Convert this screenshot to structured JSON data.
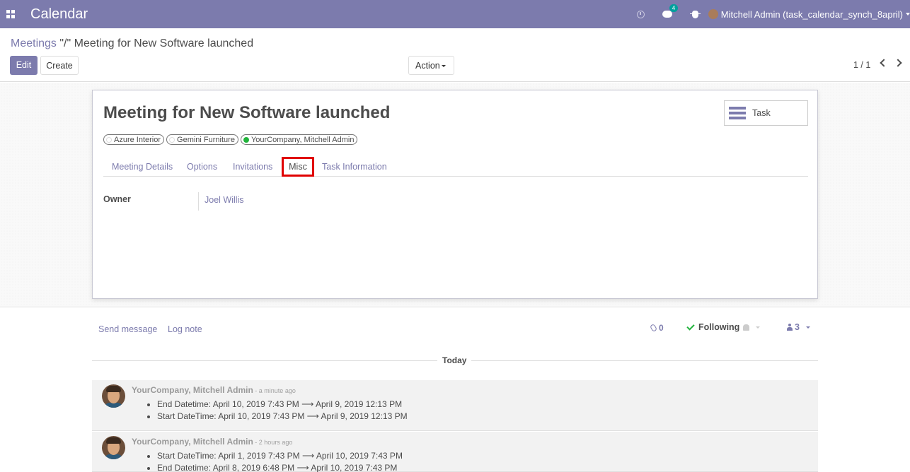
{
  "navbar": {
    "app_title": "Calendar",
    "chat_badge": "4",
    "user_label": "Mitchell Admin (task_calendar_synch_8april)"
  },
  "control": {
    "breadcrumb_parent": "Meetings",
    "breadcrumb_sep": " \"/\" ",
    "breadcrumb_current": "Meeting for New Software launched",
    "edit_label": "Edit",
    "create_label": "Create",
    "action_label": "Action",
    "pager": "1 / 1"
  },
  "record": {
    "title": "Meeting for New Software launched",
    "smart_button_label": "Task",
    "tags": [
      {
        "label": "Azure Interior",
        "status": "none"
      },
      {
        "label": "Gemini Furniture",
        "status": "none"
      },
      {
        "label": "YourCompany, Mitchell Admin",
        "status": "accepted"
      }
    ],
    "status_colors": {
      "accepted": "#21b33b"
    },
    "tabs": [
      "Meeting Details",
      "Options",
      "Invitations",
      "Misc",
      "Task Information"
    ],
    "active_tab": "Misc",
    "owner_label": "Owner",
    "owner_value": "Joel Willis"
  },
  "chatter": {
    "send_message": "Send message",
    "log_note": "Log note",
    "attachments_count": "0",
    "following_label": "Following",
    "followers_count": "3",
    "day_label": "Today",
    "messages": [
      {
        "author": "YourCompany, Mitchell Admin",
        "time": " - a minute ago",
        "changes": [
          "End Datetime: April 10, 2019 7:43 PM ⟶ April 9, 2019 12:13 PM",
          "Start DateTime: April 10, 2019 7:43 PM ⟶ April 9, 2019 12:13 PM"
        ]
      },
      {
        "author": "YourCompany, Mitchell Admin",
        "time": " - 2 hours ago",
        "changes": [
          "Start DateTime: April 1, 2019 7:43 PM ⟶ April 10, 2019 7:43 PM",
          "End Datetime: April 8, 2019 6:48 PM ⟶ April 10, 2019 7:43 PM"
        ]
      }
    ]
  },
  "colors": {
    "brand": "#7c7bad",
    "highlight": "#e00000"
  }
}
